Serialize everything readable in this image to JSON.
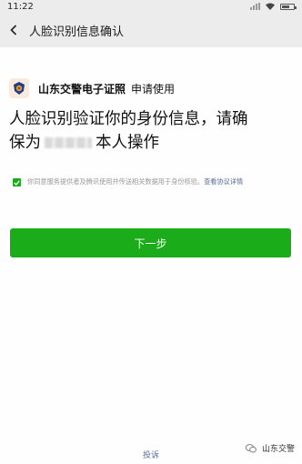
{
  "status_bar": {
    "time": "11:22",
    "battery_level": 0.7
  },
  "nav": {
    "title": "人脸识别信息确认"
  },
  "app": {
    "name": "山东交警电子证照",
    "suffix": "申请使用"
  },
  "headline": {
    "line1": "人脸识别验证你的身份信息，请确",
    "line2_prefix": "保为",
    "line2_suffix": "本人操作"
  },
  "consent": {
    "checked": true,
    "text": "你同意服务提供者及腾讯使用并传送相关数据用于身份核验。",
    "link": "查看协议详情"
  },
  "next_button": {
    "label": "下一步"
  },
  "footer": {
    "complain": "投诉"
  },
  "watermark": {
    "text": "山东交警"
  },
  "colors": {
    "accent": "#1aad19",
    "link": "#576b95",
    "header_bg": "#ececec"
  },
  "icons": [
    "back-arrow-icon",
    "police-badge-icon",
    "check-icon",
    "wechat-icon",
    "wifi-icon",
    "signal-icon",
    "battery-icon"
  ]
}
